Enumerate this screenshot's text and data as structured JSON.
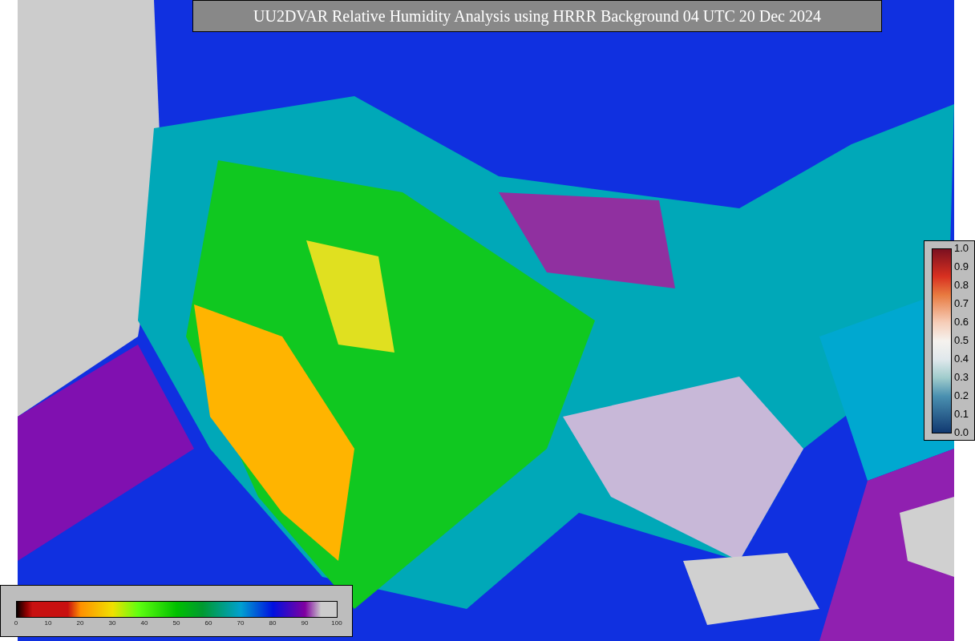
{
  "title": "UU2DVAR Relative Humidity Analysis using HRRR Background 04 UTC 20 Dec 2024",
  "humidity_colorbar": {
    "ticks": [
      "0",
      "10",
      "20",
      "30",
      "40",
      "50",
      "60",
      "70",
      "80",
      "90",
      "100"
    ]
  },
  "observation_colorbar": {
    "ticks": [
      "1.0",
      "0.9",
      "0.8",
      "0.7",
      "0.6",
      "0.5",
      "0.4",
      "0.3",
      "0.2",
      "0.1",
      "0.0"
    ]
  }
}
